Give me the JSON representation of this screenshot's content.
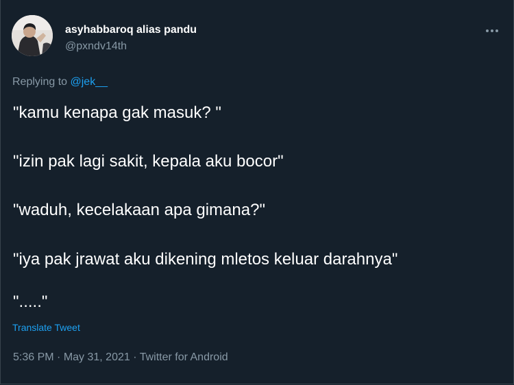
{
  "author": {
    "display_name": "asyhabbaroq alias pandu",
    "handle": "@pxndv14th",
    "avatar_icon": "profile-photo"
  },
  "more_icon": "ellipsis-icon",
  "reply": {
    "prefix": "Replying to ",
    "mention": "@jek__"
  },
  "tweet_lines": [
    "\"kamu kenapa gak masuk? \"",
    "\"izin pak lagi sakit, kepala aku bocor\"",
    "\"waduh, kecelakaan apa gimana?\"",
    "\"iya pak jrawat aku dikening mletos keluar darahnya\"",
    "\".....\""
  ],
  "translate_label": "Translate Tweet",
  "meta": {
    "time": "5:36 PM",
    "separator": " · ",
    "date": "May 31, 2021",
    "source": "Twitter for Android"
  },
  "colors": {
    "background": "#15202b",
    "text": "#ffffff",
    "secondary": "#8899a6",
    "link": "#1da1f2"
  }
}
